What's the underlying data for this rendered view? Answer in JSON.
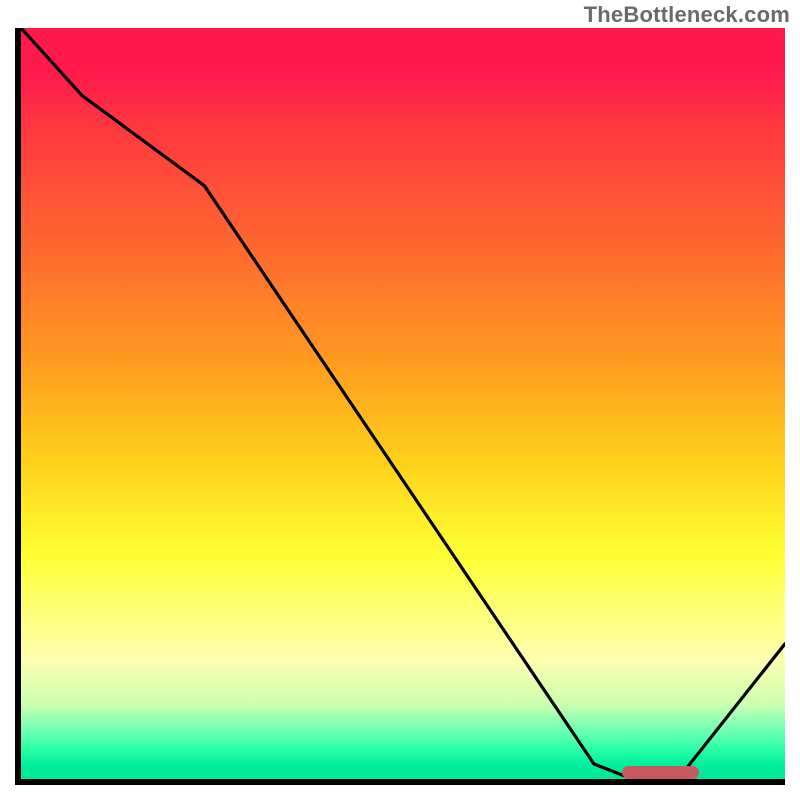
{
  "watermark": "TheBottleneck.com",
  "chart_data": {
    "type": "line",
    "title": "",
    "xlabel": "",
    "ylabel": "",
    "xlim": [
      0,
      100
    ],
    "ylim": [
      0,
      100
    ],
    "grid": false,
    "curve": {
      "x": [
        0,
        8,
        24,
        75,
        80,
        86,
        100
      ],
      "y": [
        100,
        91,
        79,
        2,
        0,
        0,
        18
      ]
    },
    "optimal_region": {
      "x_start": 78,
      "x_end": 88,
      "y": 0.8
    },
    "gradient": {
      "stops": [
        {
          "pos": 0.0,
          "color": "#ff1a4b"
        },
        {
          "pos": 0.3,
          "color": "#ff6a2f"
        },
        {
          "pos": 0.58,
          "color": "#ffd21a"
        },
        {
          "pos": 0.78,
          "color": "#ffff7a"
        },
        {
          "pos": 0.92,
          "color": "#7dffb4"
        },
        {
          "pos": 1.0,
          "color": "#00e89a"
        }
      ]
    }
  }
}
